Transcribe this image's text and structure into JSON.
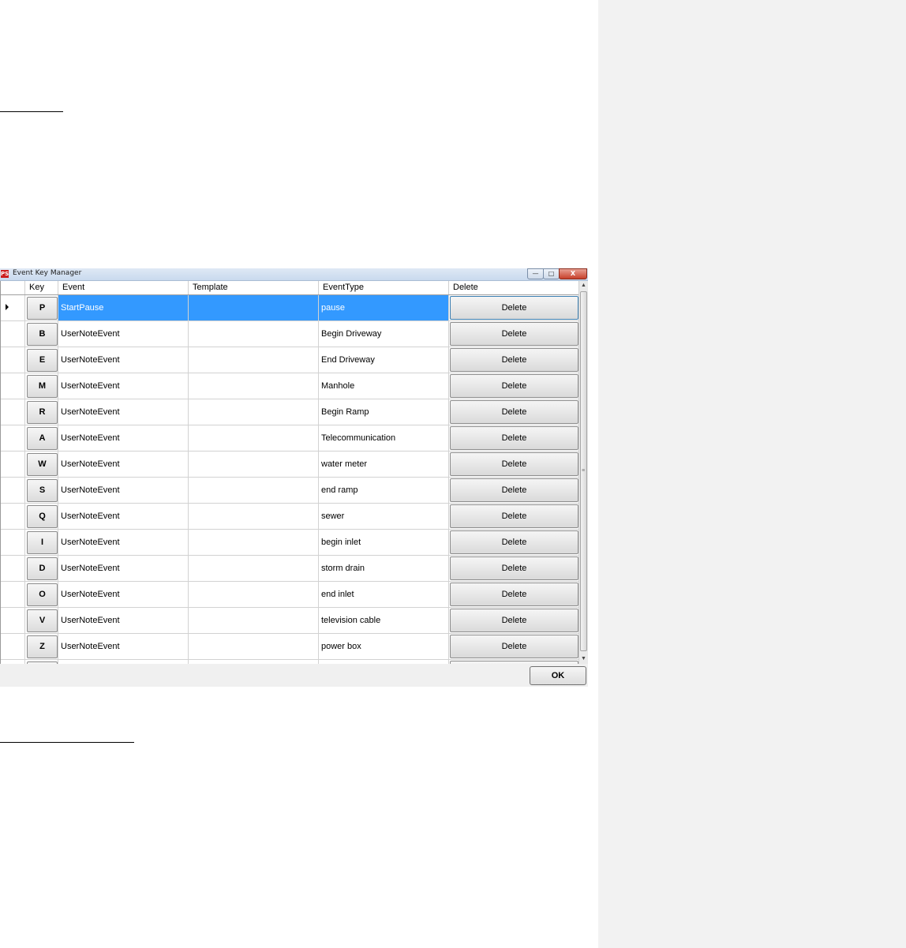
{
  "window": {
    "title": "Event Key Manager",
    "app_icon": "PS",
    "controls": {
      "minimize": "—",
      "maximize": "□",
      "close": "X"
    }
  },
  "grid": {
    "columns": [
      "Key",
      "Event",
      "Template",
      "EventType",
      "Delete"
    ],
    "rows": [
      {
        "key": "P",
        "event": "StartPause",
        "template": "",
        "type": "pause",
        "delete": "Delete",
        "selected": true
      },
      {
        "key": "B",
        "event": "UserNoteEvent",
        "template": "",
        "type": "Begin Driveway",
        "delete": "Delete"
      },
      {
        "key": "E",
        "event": "UserNoteEvent",
        "template": "",
        "type": "End Driveway",
        "delete": "Delete"
      },
      {
        "key": "M",
        "event": "UserNoteEvent",
        "template": "",
        "type": "Manhole",
        "delete": "Delete"
      },
      {
        "key": "R",
        "event": "UserNoteEvent",
        "template": "",
        "type": "Begin Ramp",
        "delete": "Delete"
      },
      {
        "key": "A",
        "event": "UserNoteEvent",
        "template": "",
        "type": "Telecommunication",
        "delete": "Delete"
      },
      {
        "key": "W",
        "event": "UserNoteEvent",
        "template": "",
        "type": "water meter",
        "delete": "Delete"
      },
      {
        "key": "S",
        "event": "UserNoteEvent",
        "template": "",
        "type": "end ramp",
        "delete": "Delete"
      },
      {
        "key": "Q",
        "event": "UserNoteEvent",
        "template": "",
        "type": "sewer",
        "delete": "Delete"
      },
      {
        "key": "I",
        "event": "UserNoteEvent",
        "template": "",
        "type": "begin inlet",
        "delete": "Delete"
      },
      {
        "key": "D",
        "event": "UserNoteEvent",
        "template": "",
        "type": "storm drain",
        "delete": "Delete"
      },
      {
        "key": "O",
        "event": "UserNoteEvent",
        "template": "",
        "type": "end inlet",
        "delete": "Delete"
      },
      {
        "key": "V",
        "event": "UserNoteEvent",
        "template": "",
        "type": "television cable",
        "delete": "Delete"
      },
      {
        "key": "Z",
        "event": "UserNoteEvent",
        "template": "",
        "type": "power box",
        "delete": "Delete"
      },
      {
        "key": "None",
        "event": "",
        "template": "",
        "type": "",
        "delete": "",
        "new_row": true
      }
    ]
  },
  "footer": {
    "ok_label": "OK"
  },
  "colors": {
    "selection": "#3399ff",
    "right_margin": "#f2f2f2"
  }
}
